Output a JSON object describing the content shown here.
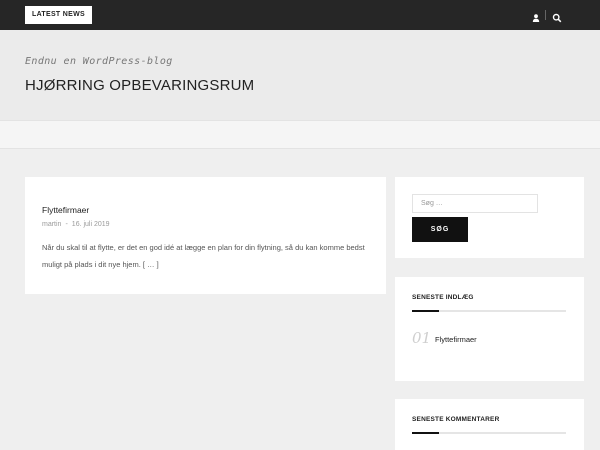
{
  "topbar": {
    "latest_news": "LATEST NEWS",
    "icons": [
      "user-icon",
      "search-icon"
    ]
  },
  "header": {
    "tagline": "Endnu en WordPress-blog",
    "site_title": "HJØRRING OPBEVARINGSRUM"
  },
  "post": {
    "title": "Flyttefirmaer",
    "author": "martin",
    "meta_separator": "-",
    "date": "16. juli 2019",
    "excerpt": "Når du skal til at flytte, er det en god idé at lægge en plan for din flytning, så du kan komme bedst muligt på plads i dit nye hjem. [ … ]"
  },
  "sidebar": {
    "search": {
      "placeholder": "Søg …",
      "button_label": "SØG"
    },
    "recent_posts": {
      "title": "SENESTE INDLÆG",
      "items": [
        {
          "number": "01",
          "label": "Flyttefirmaer"
        }
      ]
    },
    "recent_comments": {
      "title": "SENESTE KOMMENTARER"
    }
  },
  "colors": {
    "topbar": "#262626",
    "background": "#efefef",
    "card": "#ffffff",
    "accent": "#111111"
  }
}
